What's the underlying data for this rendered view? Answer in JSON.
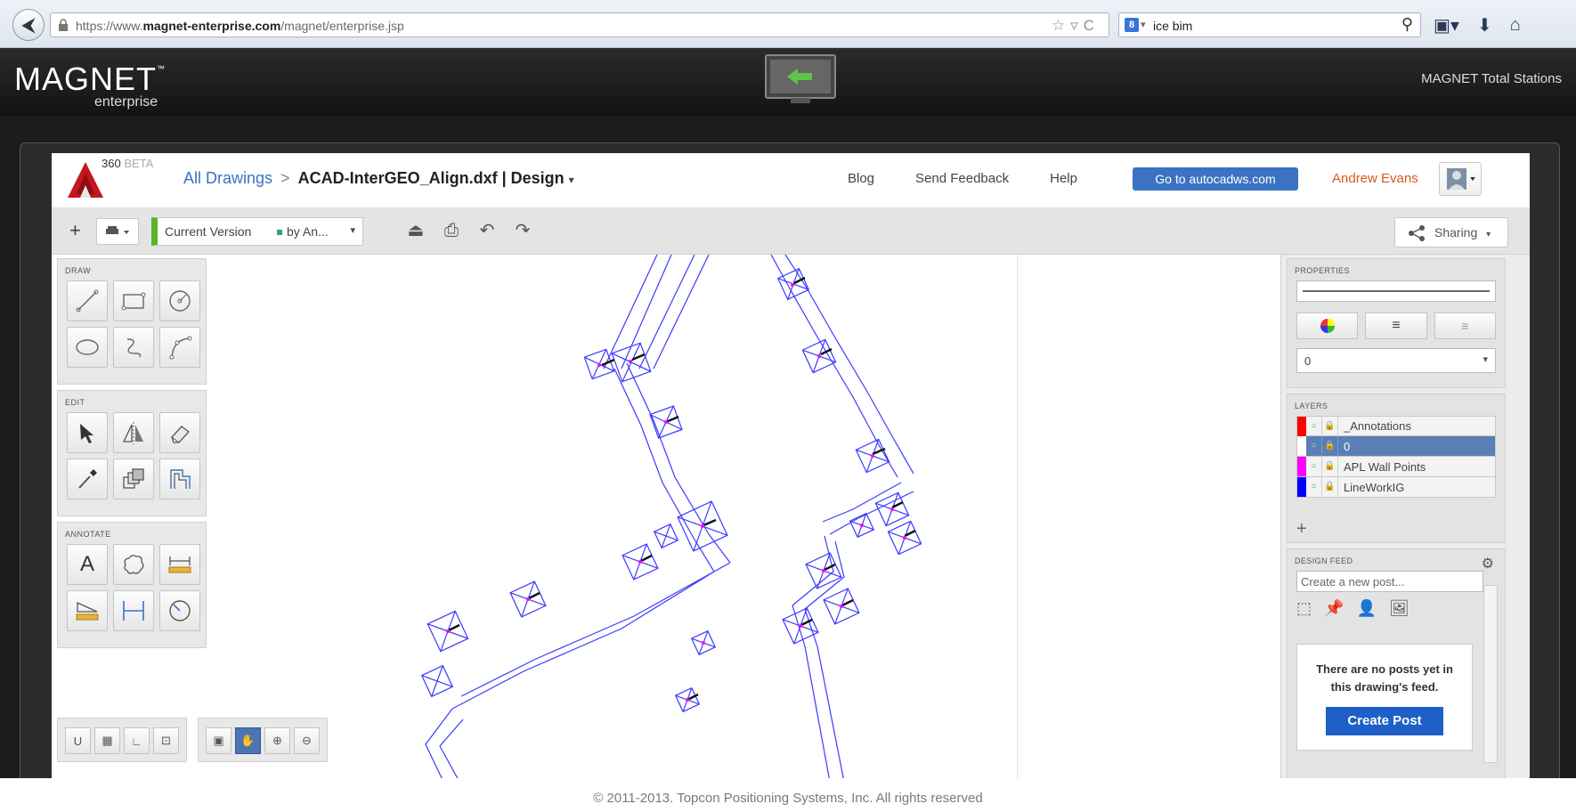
{
  "browser": {
    "url_prefix": "https://www.",
    "url_domain": "magnet-enterprise.com",
    "url_path": "/magnet/enterprise.jsp",
    "search_value": "ice bim"
  },
  "magnet": {
    "logo": "MAGNET",
    "logo_sub": "enterprise",
    "right_title": "MAGNET Total Stations",
    "footer": "© 2011-2013. Topcon Positioning Systems, Inc.  All rights reserved"
  },
  "app": {
    "beta_num": "360",
    "beta_tag": "BETA",
    "breadcrumb_link": "All Drawings",
    "breadcrumb_sep": ">",
    "file_name": "ACAD-InterGEO_Align.dxf | Design",
    "nav": [
      "Blog",
      "Send Feedback",
      "Help"
    ],
    "go_button": "Go to autocadws.com",
    "user_name": "Andrew Evans"
  },
  "toolbar": {
    "version_label": "Current Version",
    "by_label": "by An...",
    "sharing_label": "Sharing"
  },
  "palettes": {
    "draw_title": "DRAW",
    "edit_title": "EDIT",
    "annotate_title": "ANNOTATE",
    "annotate_text_tool": "A"
  },
  "bottom_tools": {
    "snap_label": "U"
  },
  "properties": {
    "title": "PROPERTIES",
    "layer_value": "0"
  },
  "layers": {
    "title": "LAYERS",
    "items": [
      {
        "name": "_Annotations",
        "color": "#ff0000"
      },
      {
        "name": "0",
        "color": "#ffffff"
      },
      {
        "name": "APL Wall Points",
        "color": "#ff00ff"
      },
      {
        "name": "LineWorkIG",
        "color": "#0000ff"
      }
    ]
  },
  "feed": {
    "title": "DESIGN FEED",
    "placeholder": "Create a new post...",
    "empty_text": "There are no posts yet in this drawing's feed.",
    "create_button": "Create Post"
  }
}
